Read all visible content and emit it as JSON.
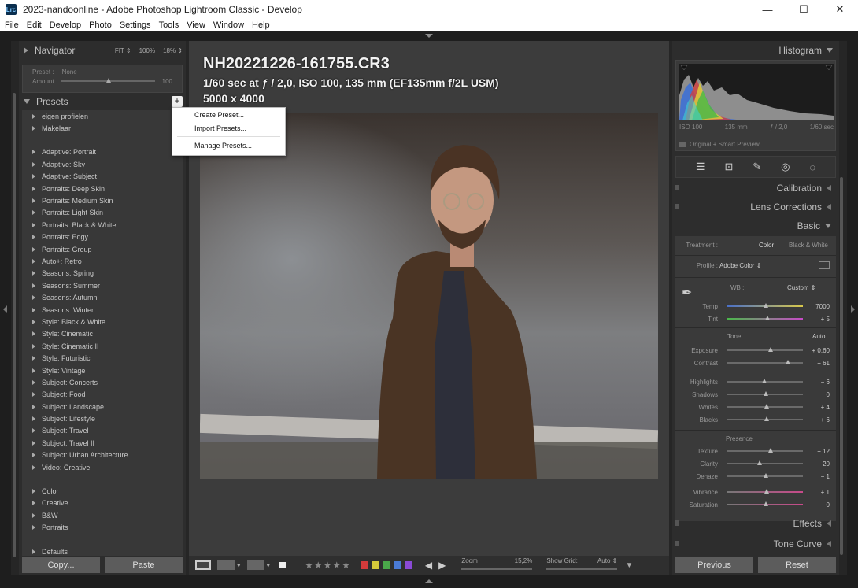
{
  "window": {
    "title": "2023-nandoonline - Adobe Photoshop Lightroom Classic - Develop",
    "icon_text": "Lrc",
    "controls": [
      "minimize-icon",
      "maximize-icon",
      "close-icon"
    ],
    "minimize_glyph": "—",
    "maximize_glyph": "☐",
    "close_glyph": "✕"
  },
  "menu": [
    "File",
    "Edit",
    "Develop",
    "Photo",
    "Settings",
    "Tools",
    "View",
    "Window",
    "Help"
  ],
  "navigator": {
    "title": "Navigator",
    "zoom_fit": "FIT ⇕",
    "zoom_100": "100%",
    "zoom_18": "18% ⇕",
    "preset_label": "Preset :",
    "preset_value": "None",
    "amount_label": "Amount",
    "amount_value": "100"
  },
  "presets": {
    "title": "Presets",
    "plus_glyph": "+",
    "groups": [
      [
        "eigen profielen",
        "Makelaar"
      ],
      [
        "Adaptive: Portrait",
        "Adaptive: Sky",
        "Adaptive: Subject",
        "Portraits: Deep Skin",
        "Portraits: Medium Skin",
        "Portraits: Light Skin",
        "Portraits: Black & White",
        "Portraits: Edgy",
        "Portraits: Group",
        "Auto+: Retro",
        "Seasons: Spring",
        "Seasons: Summer",
        "Seasons: Autumn",
        "Seasons: Winter",
        "Style: Black & White",
        "Style: Cinematic",
        "Style: Cinematic II",
        "Style: Futuristic",
        "Style: Vintage",
        "Subject: Concerts",
        "Subject: Food",
        "Subject: Landscape",
        "Subject: Lifestyle",
        "Subject: Travel",
        "Subject: Travel II",
        "Subject: Urban Architecture",
        "Video: Creative"
      ],
      [
        "Color",
        "Creative",
        "B&W",
        "Portraits"
      ],
      [
        "Defaults"
      ]
    ]
  },
  "preset_menu": {
    "create": "Create Preset...",
    "import": "Import Presets...",
    "manage": "Manage Presets..."
  },
  "left_buttons": {
    "copy": "Copy...",
    "paste": "Paste"
  },
  "photo": {
    "filename": "NH20221226-161755.CR3",
    "exif": "1/60 sec at ƒ / 2,0, ISO 100, 135 mm (EF135mm f/2L USM)",
    "dimensions": "5000 x 4000"
  },
  "toolbar": {
    "zoom_label": "Zoom",
    "zoom_value": "15,2%",
    "grid_label": "Show Grid:",
    "grid_value": "Auto ⇕",
    "label_colors": [
      "#d23b3b",
      "#d6c93a",
      "#4aa84a",
      "#4a7ad6",
      "#8a4ad6"
    ]
  },
  "histogram": {
    "title": "Histogram",
    "iso": "ISO 100",
    "focal": "135 mm",
    "aperture": "ƒ / 2,0",
    "shutter": "1/60 sec",
    "preview": "Original + Smart Preview"
  },
  "sections": {
    "calibration": "Calibration",
    "lens": "Lens Corrections",
    "basic": "Basic",
    "effects": "Effects",
    "tone_curve": "Tone Curve"
  },
  "basic": {
    "treatment_label": "Treatment :",
    "treatment_color": "Color",
    "treatment_bw": "Black & White",
    "profile_label": "Profile :",
    "profile_value": "Adobe Color ⇕",
    "wb_label": "WB :",
    "wb_value": "Custom ⇕",
    "temp_label": "Temp",
    "temp_value": "7000",
    "tint_label": "Tint",
    "tint_value": "+ 5",
    "tone_label": "Tone",
    "auto_label": "Auto",
    "exposure_label": "Exposure",
    "exposure_value": "+ 0,60",
    "contrast_label": "Contrast",
    "contrast_value": "+ 61",
    "highlights_label": "Highlights",
    "highlights_value": "− 6",
    "shadows_label": "Shadows",
    "shadows_value": "0",
    "whites_label": "Whites",
    "whites_value": "+ 4",
    "blacks_label": "Blacks",
    "blacks_value": "+ 6",
    "presence_label": "Presence",
    "texture_label": "Texture",
    "texture_value": "+ 12",
    "clarity_label": "Clarity",
    "clarity_value": "− 20",
    "dehaze_label": "Dehaze",
    "dehaze_value": "− 1",
    "vibrance_label": "Vibrance",
    "vibrance_value": "+ 1",
    "saturation_label": "Saturation",
    "saturation_value": "0"
  },
  "right_buttons": {
    "previous": "Previous",
    "reset": "Reset"
  }
}
